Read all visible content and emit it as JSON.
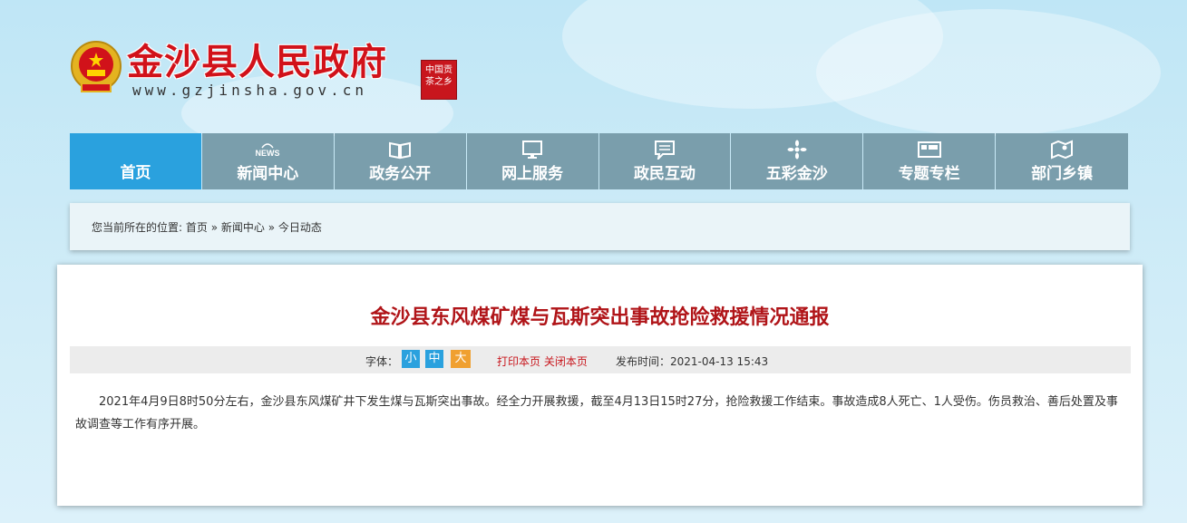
{
  "site": {
    "title": "金沙县人民政府",
    "url": "www.gzjinsha.gov.cn",
    "seal": "中国贡茶之乡"
  },
  "nav": [
    {
      "label": "首页",
      "icon": "home",
      "active": true
    },
    {
      "label": "新闻中心",
      "icon": "news-icon"
    },
    {
      "label": "政务公开",
      "icon": "book-icon"
    },
    {
      "label": "网上服务",
      "icon": "monitor-icon"
    },
    {
      "label": "政民互动",
      "icon": "chat-icon"
    },
    {
      "label": "五彩金沙",
      "icon": "flower-icon"
    },
    {
      "label": "专题专栏",
      "icon": "folder-icon"
    },
    {
      "label": "部门乡镇",
      "icon": "map-icon"
    }
  ],
  "breadcrumb": {
    "prefix": "您当前所在的位置:",
    "items": [
      "首页",
      "新闻中心",
      "今日动态"
    ],
    "sep": "»"
  },
  "article": {
    "title": "金沙县东风煤矿煤与瓦斯突出事故抢险救援情况通报",
    "font_label": "字体：",
    "font_small": "小",
    "font_medium": "中",
    "font_large": "大",
    "print": "打印本页",
    "close": "关闭本页",
    "pubtime": "发布时间：2021-04-13 15:43",
    "body": "2021年4月9日8时50分左右，金沙县东风煤矿井下发生煤与瓦斯突出事故。经全力开展救援，截至4月13日15时27分，抢险救援工作结束。事故造成8人死亡、1人受伤。伤员救治、善后处置及事故调查等工作有序开展。"
  },
  "colors": {
    "brand_red": "#d1121a",
    "nav_bg": "#7a9eac",
    "nav_active": "#2aa1de",
    "title_red": "#b01418"
  }
}
